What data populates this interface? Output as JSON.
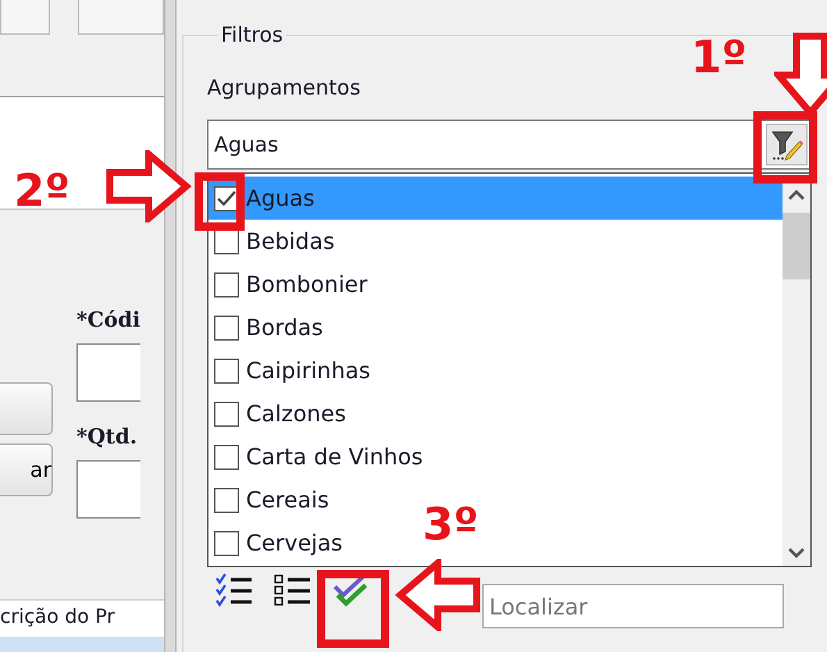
{
  "left_panel": {
    "code_label": "*Códi",
    "qty_label": "*Qtd.",
    "button_text": "ar",
    "column_header": "crição do Pr"
  },
  "filters": {
    "title": "Filtros",
    "grouping_label": "Agrupamentos",
    "grouping_value": "Aguas",
    "items": [
      {
        "label": "Aguas",
        "checked": true,
        "selected": true
      },
      {
        "label": "Bebidas",
        "checked": false,
        "selected": false
      },
      {
        "label": "Bombonier",
        "checked": false,
        "selected": false
      },
      {
        "label": "Bordas",
        "checked": false,
        "selected": false
      },
      {
        "label": "Caipirinhas",
        "checked": false,
        "selected": false
      },
      {
        "label": "Calzones",
        "checked": false,
        "selected": false
      },
      {
        "label": "Carta de Vinhos",
        "checked": false,
        "selected": false
      },
      {
        "label": "Cereais",
        "checked": false,
        "selected": false
      },
      {
        "label": "Cervejas",
        "checked": false,
        "selected": false
      }
    ],
    "search": {
      "placeholder": "Localizar"
    }
  },
  "annotations": [
    {
      "label": "1º"
    },
    {
      "label": "2º"
    },
    {
      "label": "3º"
    }
  ]
}
